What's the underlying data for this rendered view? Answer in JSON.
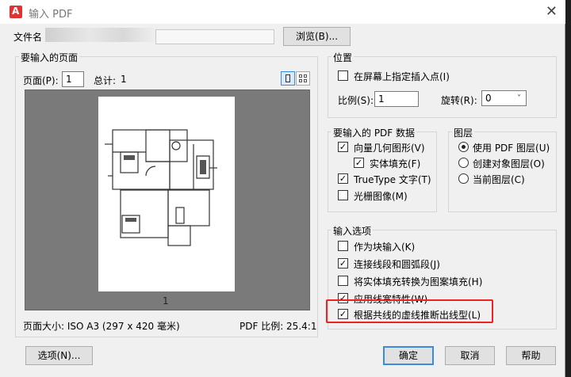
{
  "window": {
    "title": "输入 PDF",
    "close_glyph": "✕"
  },
  "file": {
    "label": "文件名",
    "browse_label": "浏览(B)..."
  },
  "pages_section": {
    "title": "要输入的页面",
    "page_label": "页面(P):",
    "page_value": "1",
    "total_label": "总计:",
    "total_value": "1",
    "preview_page_number": "1",
    "page_size": "页面大小: ISO A3 (297 x 420 毫米)",
    "pdf_scale": "PDF 比例: 25.4:1"
  },
  "position": {
    "title": "位置",
    "specify_on_screen": "在屏幕上指定插入点(I)",
    "specify_checked": false,
    "scale_label": "比例(S):",
    "scale_value": "1",
    "rotation_label": "旋转(R):",
    "rotation_value": "0"
  },
  "pdf_data": {
    "title": "要输入的 PDF 数据",
    "items": [
      {
        "label": "向量几何图形(V)",
        "checked": true
      },
      {
        "label": "实体填充(F)",
        "checked": true
      },
      {
        "label": "TrueType 文字(T)",
        "checked": true
      },
      {
        "label": "光栅图像(M)",
        "checked": false
      }
    ]
  },
  "layers": {
    "title": "图层",
    "options": [
      {
        "label": "使用 PDF 图层(U)",
        "selected": true
      },
      {
        "label": "创建对象图层(O)",
        "selected": false
      },
      {
        "label": "当前图层(C)",
        "selected": false
      }
    ]
  },
  "import_options": {
    "title": "输入选项",
    "items": [
      {
        "label": "作为块输入(K)",
        "checked": false
      },
      {
        "label": "连接线段和圆弧段(J)",
        "checked": true
      },
      {
        "label": "将实体填充转换为图案填充(H)",
        "checked": false
      },
      {
        "label": "应用线宽特性(W)",
        "checked": true
      },
      {
        "label": "根据共线的虚线推断出线型(L)",
        "checked": true
      }
    ]
  },
  "buttons": {
    "options": "选项(N)...",
    "ok": "确定",
    "cancel": "取消",
    "help": "帮助"
  },
  "check_glyph": "✓"
}
